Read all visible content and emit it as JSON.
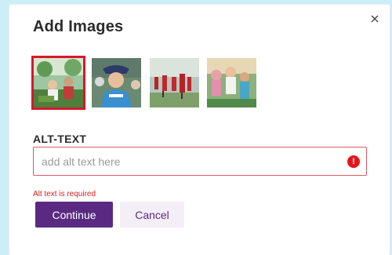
{
  "dialog": {
    "title": "Add Images",
    "close_label": "×"
  },
  "thumbnails": [
    {
      "name": "garden-volunteers-image",
      "selected": true
    },
    {
      "name": "woman-smiling-image",
      "selected": false
    },
    {
      "name": "runners-group-image",
      "selected": false
    },
    {
      "name": "family-outdoors-image",
      "selected": false
    }
  ],
  "alt_text": {
    "label": "ALT-TEXT",
    "placeholder": "add alt text here",
    "value": "",
    "error_icon": "!",
    "error_message": "Alt text is required"
  },
  "actions": {
    "continue_label": "Continue",
    "cancel_label": "Cancel"
  },
  "colors": {
    "accent": "#5a2a82",
    "error": "#d6182b",
    "background": "#cdeef6"
  }
}
